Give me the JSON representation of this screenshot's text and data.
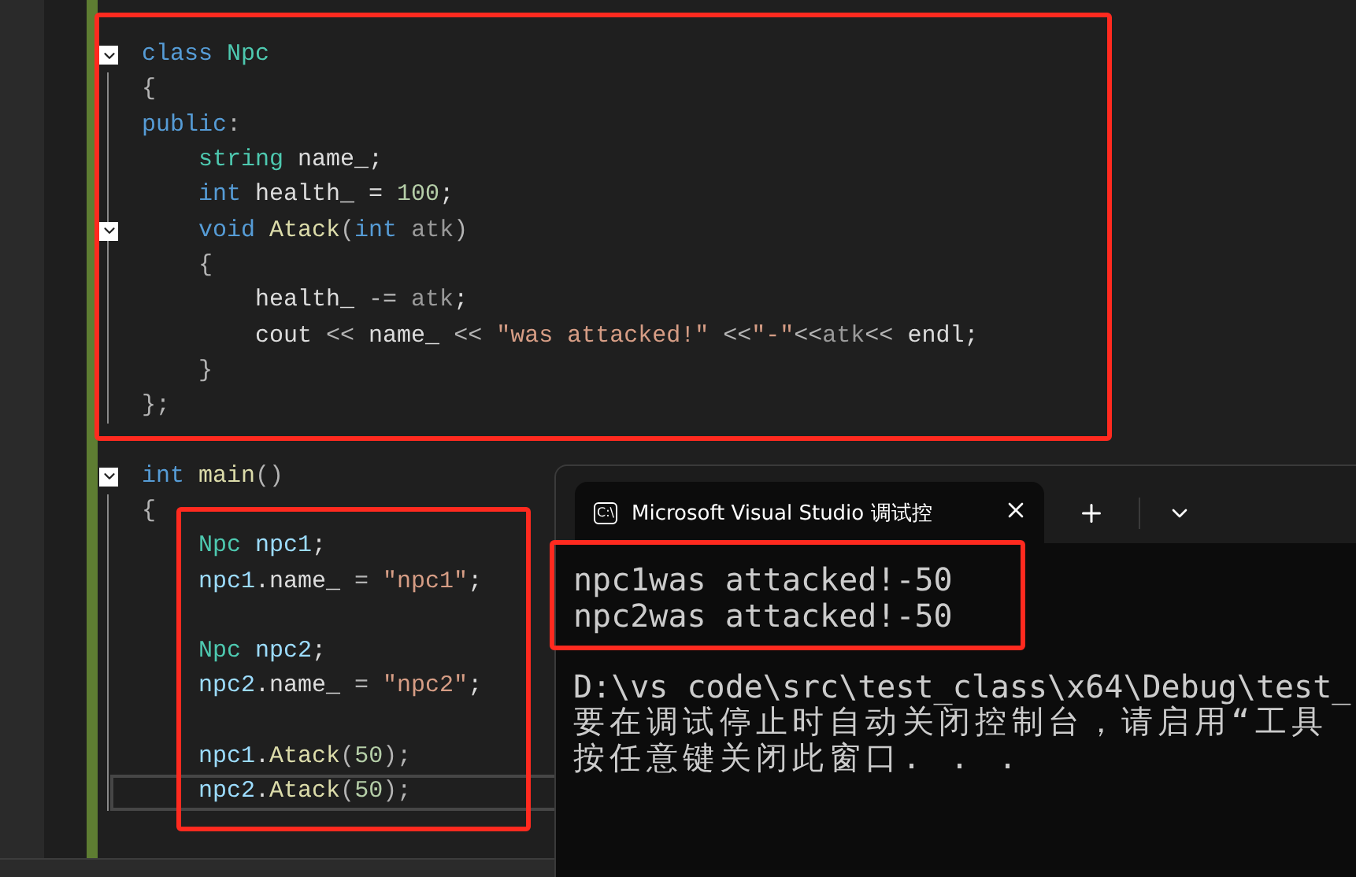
{
  "editor": {
    "lines": [
      {
        "kind": "code",
        "folding": true,
        "current": false,
        "tokens": [
          {
            "kind": "kw",
            "t": "class"
          },
          {
            "kind": "type",
            "t": " Npc"
          }
        ]
      },
      {
        "kind": "code",
        "folding": false,
        "current": false,
        "tokens": [
          {
            "kind": "punct",
            "t": "{"
          }
        ]
      },
      {
        "kind": "code",
        "folding": false,
        "current": false,
        "tokens": [
          {
            "kind": "kw",
            "t": "public"
          },
          {
            "kind": "punct",
            "t": ":"
          }
        ]
      },
      {
        "kind": "code",
        "folding": false,
        "current": false,
        "tokens": [
          {
            "kind": "type",
            "t": "    string"
          },
          {
            "kind": "plain",
            "t": " name_;"
          }
        ]
      },
      {
        "kind": "code",
        "folding": false,
        "current": false,
        "tokens": [
          {
            "kind": "kw",
            "t": "    int"
          },
          {
            "kind": "plain",
            "t": " health_ = "
          },
          {
            "kind": "num",
            "t": "100"
          },
          {
            "kind": "plain",
            "t": ";"
          }
        ]
      },
      {
        "kind": "code",
        "folding": true,
        "current": false,
        "tokens": [
          {
            "kind": "kw",
            "t": "    void"
          },
          {
            "kind": "fn",
            "t": " Atack"
          },
          {
            "kind": "punct",
            "t": "("
          },
          {
            "kind": "kw",
            "t": "int"
          },
          {
            "kind": "param",
            "t": " atk"
          },
          {
            "kind": "punct",
            "t": ")"
          }
        ]
      },
      {
        "kind": "code",
        "folding": false,
        "current": false,
        "tokens": [
          {
            "kind": "punct",
            "t": "    {"
          }
        ]
      },
      {
        "kind": "code",
        "folding": false,
        "current": false,
        "tokens": [
          {
            "kind": "plain",
            "t": "        health_ "
          },
          {
            "kind": "punct",
            "t": "-="
          },
          {
            "kind": "param",
            "t": " atk"
          },
          {
            "kind": "plain",
            "t": ";"
          }
        ]
      },
      {
        "kind": "code",
        "folding": false,
        "current": false,
        "tokens": [
          {
            "kind": "plain",
            "t": "        cout "
          },
          {
            "kind": "punct",
            "t": "<<"
          },
          {
            "kind": "plain",
            "t": " name_ "
          },
          {
            "kind": "punct",
            "t": "<<"
          },
          {
            "kind": "str",
            "t": " \"was attacked!\""
          },
          {
            "kind": "punct",
            "t": " <<"
          },
          {
            "kind": "str",
            "t": "\"-\""
          },
          {
            "kind": "punct",
            "t": "<<"
          },
          {
            "kind": "param",
            "t": "atk"
          },
          {
            "kind": "punct",
            "t": "<<"
          },
          {
            "kind": "plain",
            "t": " endl;"
          }
        ]
      },
      {
        "kind": "code",
        "folding": false,
        "current": false,
        "tokens": [
          {
            "kind": "punct",
            "t": "    }"
          }
        ]
      },
      {
        "kind": "code",
        "folding": false,
        "current": false,
        "tokens": [
          {
            "kind": "punct",
            "t": "};"
          }
        ]
      },
      {
        "kind": "blank",
        "folding": false,
        "current": false
      },
      {
        "kind": "code",
        "folding": true,
        "current": false,
        "tokens": [
          {
            "kind": "kw",
            "t": "int"
          },
          {
            "kind": "fn",
            "t": " main"
          },
          {
            "kind": "punct",
            "t": "()"
          }
        ]
      },
      {
        "kind": "code",
        "folding": false,
        "current": false,
        "tokens": [
          {
            "kind": "punct",
            "t": "{"
          }
        ]
      },
      {
        "kind": "code",
        "folding": false,
        "current": false,
        "tokens": [
          {
            "kind": "type",
            "t": "    Npc"
          },
          {
            "kind": "var",
            "t": " npc1"
          },
          {
            "kind": "plain",
            "t": ";"
          }
        ]
      },
      {
        "kind": "code",
        "folding": false,
        "current": false,
        "tokens": [
          {
            "kind": "var",
            "t": "    npc1"
          },
          {
            "kind": "plain",
            "t": ".name_ "
          },
          {
            "kind": "punct",
            "t": "="
          },
          {
            "kind": "str",
            "t": " \"npc1\""
          },
          {
            "kind": "plain",
            "t": ";"
          }
        ]
      },
      {
        "kind": "blank",
        "folding": false,
        "current": false
      },
      {
        "kind": "code",
        "folding": false,
        "current": false,
        "tokens": [
          {
            "kind": "type",
            "t": "    Npc"
          },
          {
            "kind": "var",
            "t": " npc2"
          },
          {
            "kind": "plain",
            "t": ";"
          }
        ]
      },
      {
        "kind": "code",
        "folding": false,
        "current": false,
        "tokens": [
          {
            "kind": "var",
            "t": "    npc2"
          },
          {
            "kind": "plain",
            "t": ".name_ "
          },
          {
            "kind": "punct",
            "t": "="
          },
          {
            "kind": "str",
            "t": " \"npc2\""
          },
          {
            "kind": "plain",
            "t": ";"
          }
        ]
      },
      {
        "kind": "blank",
        "folding": false,
        "current": false
      },
      {
        "kind": "code",
        "folding": false,
        "current": false,
        "tokens": [
          {
            "kind": "var",
            "t": "    npc1"
          },
          {
            "kind": "plain",
            "t": "."
          },
          {
            "kind": "fn",
            "t": "Atack"
          },
          {
            "kind": "punct",
            "t": "("
          },
          {
            "kind": "num",
            "t": "50"
          },
          {
            "kind": "punct",
            "t": ");"
          }
        ]
      },
      {
        "kind": "code",
        "folding": false,
        "current": true,
        "tokens": [
          {
            "kind": "var",
            "t": "    npc2"
          },
          {
            "kind": "plain",
            "t": "."
          },
          {
            "kind": "fn",
            "t": "Atack"
          },
          {
            "kind": "punct",
            "t": "("
          },
          {
            "kind": "num",
            "t": "50"
          },
          {
            "kind": "punct",
            "t": ");"
          }
        ]
      }
    ]
  },
  "terminal": {
    "tab": {
      "icon_text": "C:\\",
      "title": "Microsoft Visual Studio 调试控"
    },
    "lines": [
      {
        "kind": "ascii",
        "text": "npc1was attacked!-50"
      },
      {
        "kind": "ascii",
        "text": "npc2was attacked!-50"
      },
      {
        "kind": "blank"
      },
      {
        "kind": "ascii",
        "text": "D:\\vs code\\src\\test_class\\x64\\Debug\\test_"
      },
      {
        "kind": "cjk",
        "text": "要在调试停止时自动关闭控制台，请启用“工具"
      },
      {
        "kind": "cjk",
        "text": "按任意键关闭此窗口. . ."
      }
    ]
  }
}
